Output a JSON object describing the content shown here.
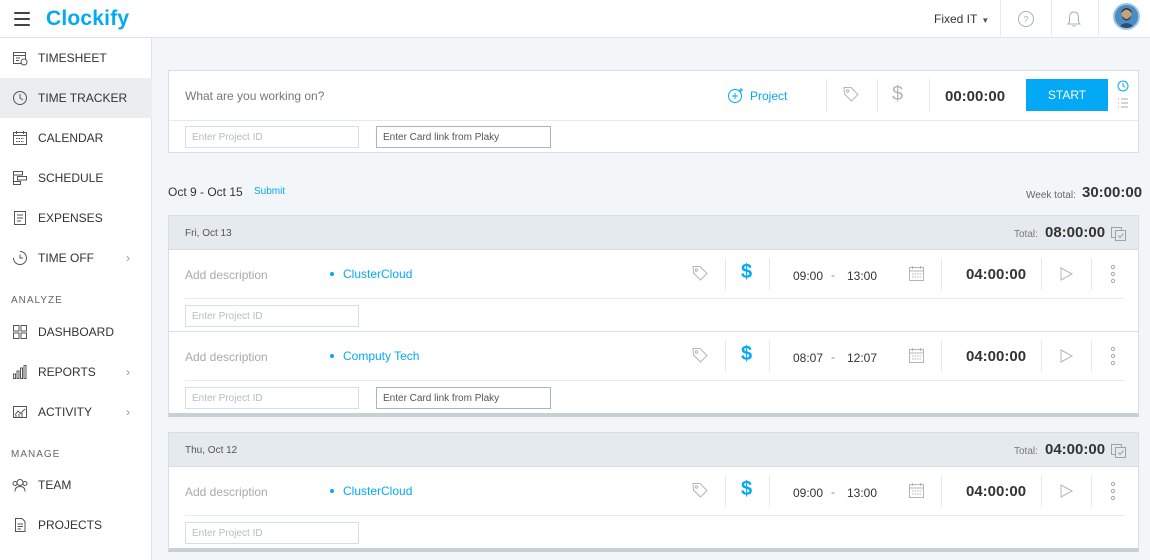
{
  "app": {
    "logo": "Clockify"
  },
  "topbar": {
    "workspace": "Fixed IT",
    "caret": "▼"
  },
  "sidebar": {
    "items": [
      {
        "label": "Timesheet",
        "icon": "timesheet-icon"
      },
      {
        "label": "Time Tracker",
        "icon": "clock-icon",
        "active": true
      },
      {
        "label": "Calendar",
        "icon": "calendar-icon"
      },
      {
        "label": "Schedule",
        "icon": "schedule-icon"
      },
      {
        "label": "Expenses",
        "icon": "receipt-icon"
      },
      {
        "label": "Time Off",
        "icon": "time-off-icon",
        "chevron": "›"
      }
    ],
    "analyze_label": "Analyze",
    "analyze_items": [
      {
        "label": "Dashboard",
        "icon": "dashboard-icon"
      },
      {
        "label": "Reports",
        "icon": "reports-icon",
        "chevron": "›"
      },
      {
        "label": "Activity",
        "icon": "activity-icon",
        "chevron": "›"
      }
    ],
    "manage_label": "Manage",
    "manage_items": [
      {
        "label": "Team",
        "icon": "team-icon"
      },
      {
        "label": "Projects",
        "icon": "projects-icon"
      }
    ]
  },
  "tracker": {
    "description_placeholder": "What are you working on?",
    "project_label": "Project",
    "billable_symbol": "$",
    "timer": "00:00:00",
    "start_label": "START",
    "project_id_placeholder": "Enter Project ID",
    "card_link_placeholder": "Enter Card link from Plaky"
  },
  "week": {
    "range": "Oct 9 - Oct 15",
    "submit_label": "Submit",
    "total_label": "Week total:",
    "total": "30:00:00"
  },
  "days": [
    {
      "date": "Fri, Oct 13",
      "total_label": "Total:",
      "total": "08:00:00",
      "entries": [
        {
          "description_placeholder": "Add description",
          "project": "ClusterCloud",
          "billable_symbol": "$",
          "start": "09:00",
          "dash": "-",
          "end": "13:00",
          "duration": "04:00:00",
          "project_id_placeholder": "Enter Project ID",
          "card_link_placeholder": ""
        },
        {
          "description_placeholder": "Add description",
          "project": "Computy Tech",
          "billable_symbol": "$",
          "start": "08:07",
          "dash": "-",
          "end": "12:07",
          "duration": "04:00:00",
          "project_id_placeholder": "Enter Project ID",
          "card_link_placeholder": "Enter Card link from Plaky"
        }
      ]
    },
    {
      "date": "Thu, Oct 12",
      "total_label": "Total:",
      "total": "04:00:00",
      "entries": [
        {
          "description_placeholder": "Add description",
          "project": "ClusterCloud",
          "billable_symbol": "$",
          "start": "09:00",
          "dash": "-",
          "end": "13:00",
          "duration": "04:00:00",
          "project_id_placeholder": "Enter Project ID",
          "card_link_placeholder": ""
        }
      ]
    }
  ],
  "colors": {
    "accent": "#03a9f4",
    "background": "#f2f6f8",
    "header": "#e4eaee"
  }
}
